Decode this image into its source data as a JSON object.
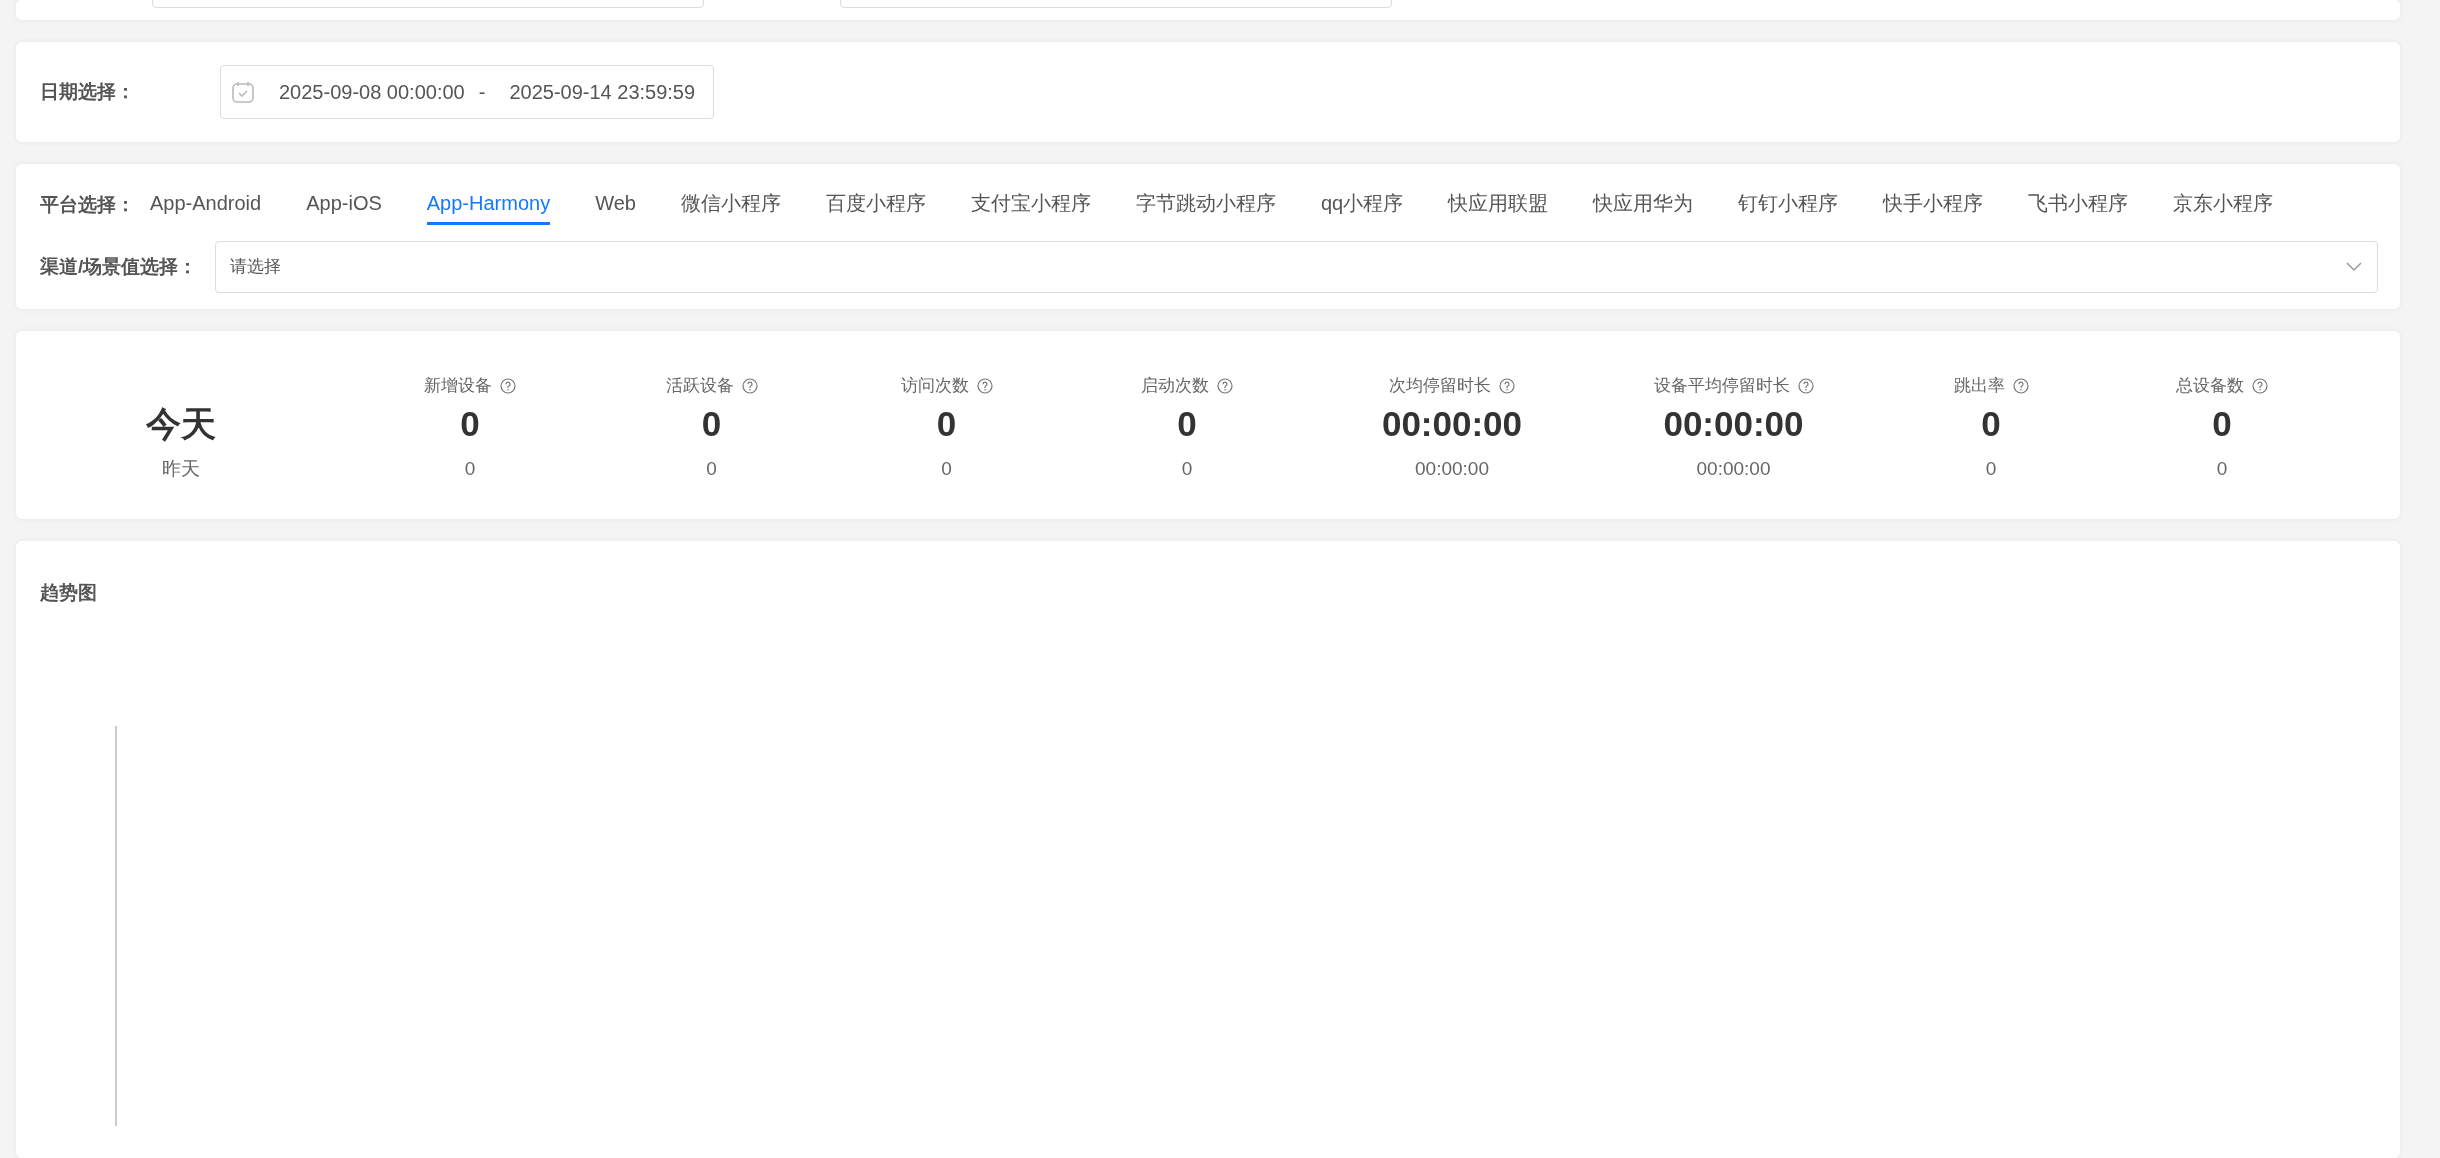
{
  "date_filter": {
    "label": "日期选择：",
    "start": "2025-09-08 00:00:00",
    "separator": "-",
    "end": "2025-09-14 23:59:59"
  },
  "platform_filter": {
    "label": "平台选择：",
    "tabs": [
      {
        "label": "App-Android",
        "selected": false
      },
      {
        "label": "App-iOS",
        "selected": false
      },
      {
        "label": "App-Harmony",
        "selected": true
      },
      {
        "label": "Web",
        "selected": false
      },
      {
        "label": "微信小程序",
        "selected": false
      },
      {
        "label": "百度小程序",
        "selected": false
      },
      {
        "label": "支付宝小程序",
        "selected": false
      },
      {
        "label": "字节跳动小程序",
        "selected": false
      },
      {
        "label": "qq小程序",
        "selected": false
      },
      {
        "label": "快应用联盟",
        "selected": false
      },
      {
        "label": "快应用华为",
        "selected": false
      },
      {
        "label": "钉钉小程序",
        "selected": false
      },
      {
        "label": "快手小程序",
        "selected": false
      },
      {
        "label": "飞书小程序",
        "selected": false
      },
      {
        "label": "京东小程序",
        "selected": false
      }
    ]
  },
  "channel_filter": {
    "label": "渠道/场景值选择：",
    "placeholder": "请选择"
  },
  "overview": {
    "today_label": "今天",
    "yesterday_label": "昨天",
    "metrics": [
      {
        "label": "新增设备",
        "today": "0",
        "yesterday": "0"
      },
      {
        "label": "活跃设备",
        "today": "0",
        "yesterday": "0"
      },
      {
        "label": "访问次数",
        "today": "0",
        "yesterday": "0"
      },
      {
        "label": "启动次数",
        "today": "0",
        "yesterday": "0"
      },
      {
        "label": "次均停留时长",
        "today": "00:00:00",
        "yesterday": "00:00:00"
      },
      {
        "label": "设备平均停留时长",
        "today": "00:00:00",
        "yesterday": "00:00:00"
      },
      {
        "label": "跳出率",
        "today": "0",
        "yesterday": "0"
      },
      {
        "label": "总设备数",
        "today": "0",
        "yesterday": "0"
      }
    ]
  },
  "trend": {
    "title": "趋势图"
  }
}
